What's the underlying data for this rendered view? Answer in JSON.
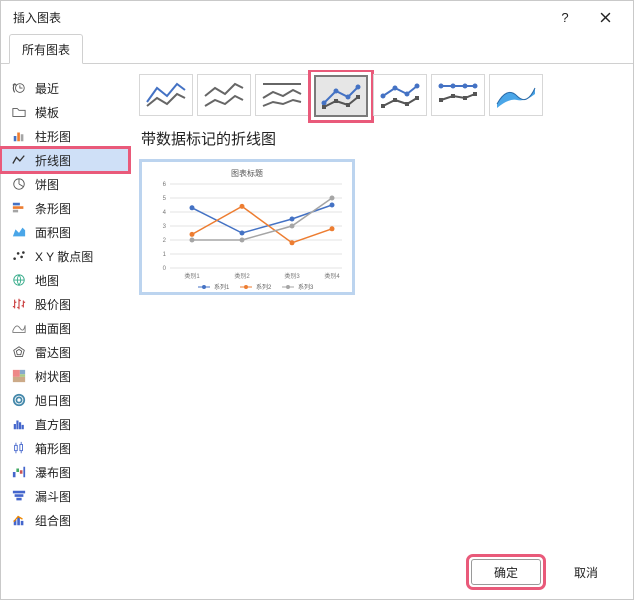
{
  "dialog": {
    "title": "插入图表",
    "tab_all": "所有图表",
    "ok_label": "确定",
    "cancel_label": "取消"
  },
  "sidebar": {
    "items": [
      {
        "label": "最近"
      },
      {
        "label": "模板"
      },
      {
        "label": "柱形图"
      },
      {
        "label": "折线图"
      },
      {
        "label": "饼图"
      },
      {
        "label": "条形图"
      },
      {
        "label": "面积图"
      },
      {
        "label": "X Y 散点图"
      },
      {
        "label": "地图"
      },
      {
        "label": "股价图"
      },
      {
        "label": "曲面图"
      },
      {
        "label": "雷达图"
      },
      {
        "label": "树状图"
      },
      {
        "label": "旭日图"
      },
      {
        "label": "直方图"
      },
      {
        "label": "箱形图"
      },
      {
        "label": "瀑布图"
      },
      {
        "label": "漏斗图"
      },
      {
        "label": "组合图"
      }
    ]
  },
  "main": {
    "subtype_title": "带数据标记的折线图"
  },
  "chart_data": {
    "type": "line",
    "title": "图表标题",
    "categories": [
      "类别1",
      "类别2",
      "类别3",
      "类别4"
    ],
    "series": [
      {
        "name": "系列1",
        "values": [
          4.3,
          2.5,
          3.5,
          4.5
        ],
        "color": "#4472c4"
      },
      {
        "name": "系列2",
        "values": [
          2.4,
          4.4,
          1.8,
          2.8
        ],
        "color": "#ed7d31"
      },
      {
        "name": "系列3",
        "values": [
          2.0,
          2.0,
          3.0,
          5.0
        ],
        "color": "#a5a5a5"
      }
    ],
    "ylim": [
      0,
      6
    ],
    "yticks": [
      0,
      1,
      2,
      3,
      4,
      5,
      6
    ]
  }
}
